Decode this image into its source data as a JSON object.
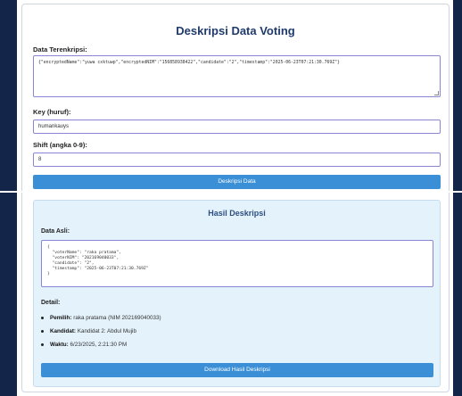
{
  "page": {
    "title": "Deskripsi Data Voting"
  },
  "form": {
    "encrypted_label": "Data Terenkripsi:",
    "encrypted_value": "{\"encryptedName\":\"yuwa cxktuwp\",\"encryptedNIM\":\"156858938422\",\"candidate\":\"2\",\"timestamp\":\"2025-06-23T07:21:30.769Z\"}",
    "key_label": "Key (huruf):",
    "key_value": "humankauys",
    "shift_label": "Shift (angka 0-9):",
    "shift_value": "8",
    "decrypt_button": "Deskripsi Data"
  },
  "result": {
    "title": "Hasil Deskripsi",
    "original_label": "Data Asli:",
    "original_json": "{\n  \"voterName\": \"raka pratama\",\n  \"voterNIM\": \"202169040033\",\n  \"candidate\": \"2\",\n  \"timestamp\": \"2025-06-23T07:21:30.769Z\"\n}",
    "detail_label": "Detail:",
    "details": [
      {
        "key": "Pemilih:",
        "value": "raka pratama (NIM 202169040033)"
      },
      {
        "key": "Kandidat:",
        "value": "Kandidat 2: Abdul Mujib"
      },
      {
        "key": "Waktu:",
        "value": "6/23/2025, 2:21:30 PM"
      }
    ],
    "download_button": "Download Hasil Deskripsi"
  },
  "colors": {
    "frame": "#14254a",
    "title": "#1f3a6b",
    "button": "#3a8fd6",
    "result_bg": "#e4f2fb",
    "input_border": "#8a86d6"
  }
}
